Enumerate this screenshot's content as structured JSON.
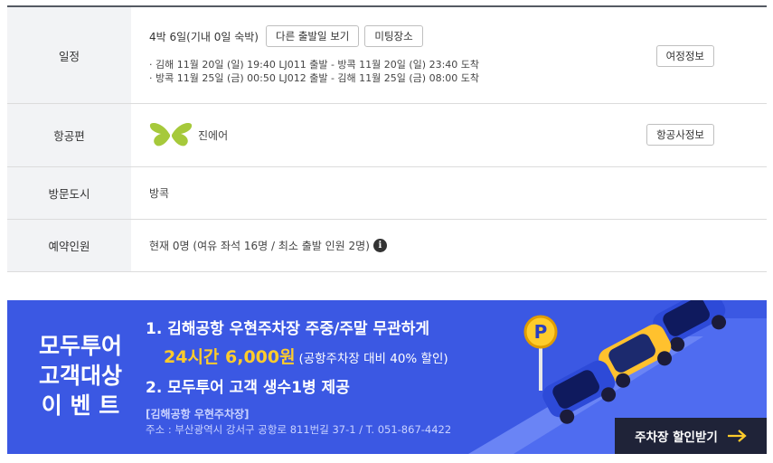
{
  "schedule": {
    "label": "일정",
    "duration": "4박 6일(기내 0일 숙박)",
    "other_dates_button": "다른 출발일 보기",
    "meeting_button": "미팅장소",
    "outbound": "· 김해 11월 20일 (일) 19:40 LJ011 출발 - 방콕 11월 20일 (일) 23:40 도착",
    "inbound": "· 방콕 11월 25일 (금) 00:50 LJ012 출발 - 김해 11월 25일 (금) 08:00 도착",
    "itinerary_button": "여정정보"
  },
  "airline": {
    "label": "항공편",
    "name": "진에어",
    "info_button": "항공사정보",
    "logo_color": "#a6c93b"
  },
  "city": {
    "label": "방문도시",
    "value": "방콕"
  },
  "people": {
    "label": "예약인원",
    "value": "현재 0명 (여유 좌석 16명 / 최소 출발 인원 2명)",
    "info_icon": "i"
  },
  "banner": {
    "brand_line1": "모두투어",
    "brand_line2": "고객대상",
    "brand_line3": "이 벤 트",
    "line1": "1. 김해공항 우현주차장 주중/주말 무관하게",
    "highlight": "24시간 6,000원",
    "highlight_note": "(공항주차장 대비 40% 할인)",
    "line3": "2. 모두투어 고객 생수1병 제공",
    "location_title": "[김해공항 우현주차장]",
    "address": "주소 : 부산광역시 강서구 공항로 811번길 37-1 / T. 051-867-4422",
    "cta": "주차장 할인받기",
    "parking_sign": "P",
    "bg_color": "#3b58e3",
    "highlight_color": "#ffcc2b"
  }
}
